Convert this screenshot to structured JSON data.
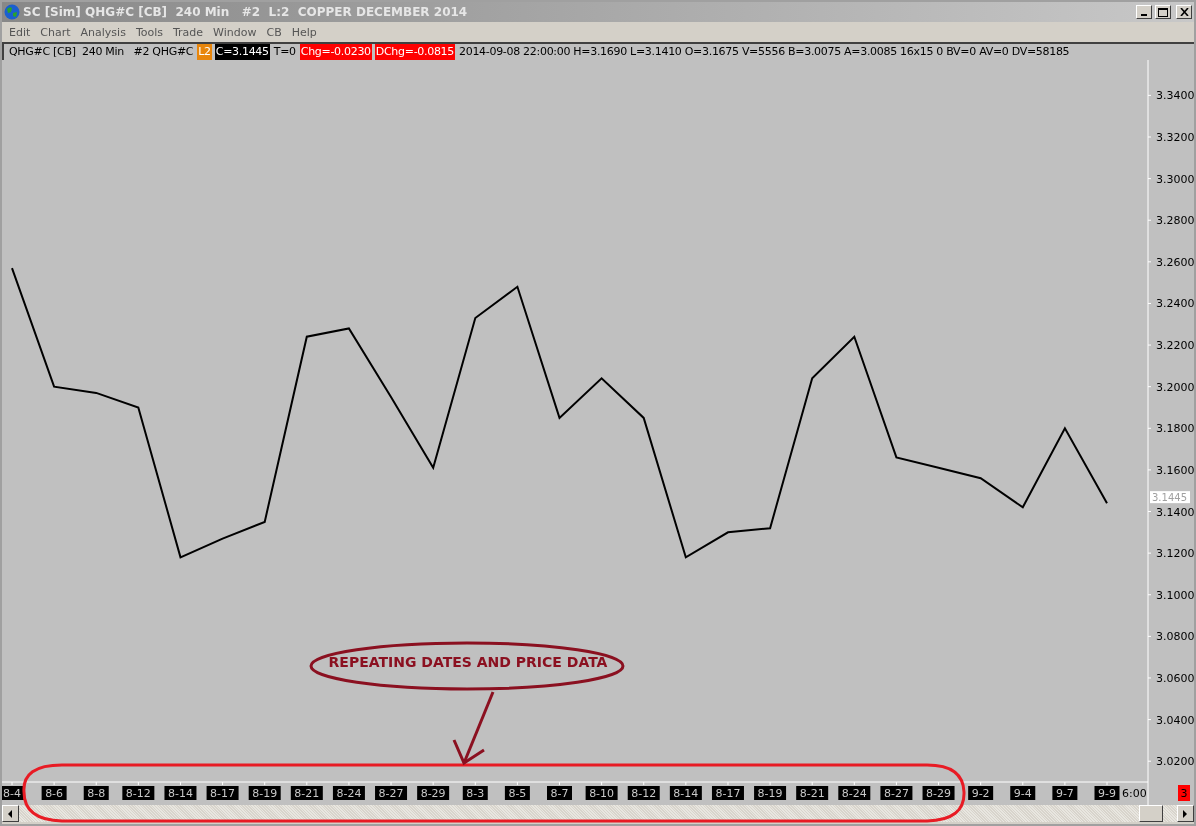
{
  "window": {
    "title": "SC [Sim] QHG#C [CB]  240 Min   #2  L:2  COPPER DECEMBER 2014"
  },
  "menu": [
    "Edit",
    "Chart",
    "Analysis",
    "Tools",
    "Trade",
    "Window",
    "CB",
    "Help"
  ],
  "info_bar": [
    {
      "kind": "plain",
      "text": "QHG#C [CB]  240 Min   #2 QHG#C"
    },
    {
      "kind": "orange",
      "text": "L2"
    },
    {
      "kind": "black",
      "text": "C=3.1445"
    },
    {
      "kind": "plain",
      "text": "T=0"
    },
    {
      "kind": "red",
      "text": "Chg=-0.0230"
    },
    {
      "kind": "red",
      "text": "DChg=-0.0815"
    },
    {
      "kind": "plain",
      "text": "2014-09-08 22:00:00 H=3.1690 L=3.1410 O=3.1675 V=5556 B=3.0075 A=3.0085 16x15 0 BV=0 AV=0 DV=58185"
    }
  ],
  "chart": {
    "chart_data": {
      "type": "line",
      "categories": [
        "8-4",
        "8-6",
        "8-8",
        "8-12",
        "8-14",
        "8-17",
        "8-19",
        "8-21",
        "8-24",
        "8-27",
        "8-29",
        "8-3",
        "8-5",
        "8-7",
        "8-10",
        "8-12",
        "8-14",
        "8-17",
        "8-19",
        "8-21",
        "8-24",
        "8-27",
        "8-29",
        "9-2",
        "9-4",
        "9-7",
        "9-9"
      ],
      "values": [
        3.257,
        3.2,
        3.197,
        3.19,
        3.118,
        3.127,
        3.135,
        3.224,
        3.228,
        3.195,
        3.161,
        3.233,
        3.248,
        3.185,
        3.204,
        3.185,
        3.118,
        3.13,
        3.132,
        3.204,
        3.224,
        3.166,
        3.161,
        3.156,
        3.142,
        3.18,
        3.144
      ],
      "ylim": [
        3.01,
        3.357
      ],
      "yticks": [
        {
          "value": 3.34,
          "label": "3.3400"
        },
        {
          "value": 3.32,
          "label": "3.3200"
        },
        {
          "value": 3.3,
          "label": "3.3000"
        },
        {
          "value": 3.28,
          "label": "3.2800"
        },
        {
          "value": 3.26,
          "label": "3.2600"
        },
        {
          "value": 3.24,
          "label": "3.2400"
        },
        {
          "value": 3.22,
          "label": "3.2200"
        },
        {
          "value": 3.2,
          "label": "3.2000"
        },
        {
          "value": 3.18,
          "label": "3.1800"
        },
        {
          "value": 3.16,
          "label": "3.1600"
        },
        {
          "value": 3.14,
          "label": "3.1400"
        },
        {
          "value": 3.12,
          "label": "3.1200"
        },
        {
          "value": 3.1,
          "label": "3.1000"
        },
        {
          "value": 3.08,
          "label": "3.0800"
        },
        {
          "value": 3.06,
          "label": "3.0600"
        },
        {
          "value": 3.04,
          "label": "3.0400"
        },
        {
          "value": 3.02,
          "label": "3.0200"
        }
      ]
    },
    "last_price": "3.1445",
    "time_label": "6:00",
    "counter": "3"
  },
  "callout": {
    "text": "REPEATING DATES AND PRICE DATA"
  }
}
